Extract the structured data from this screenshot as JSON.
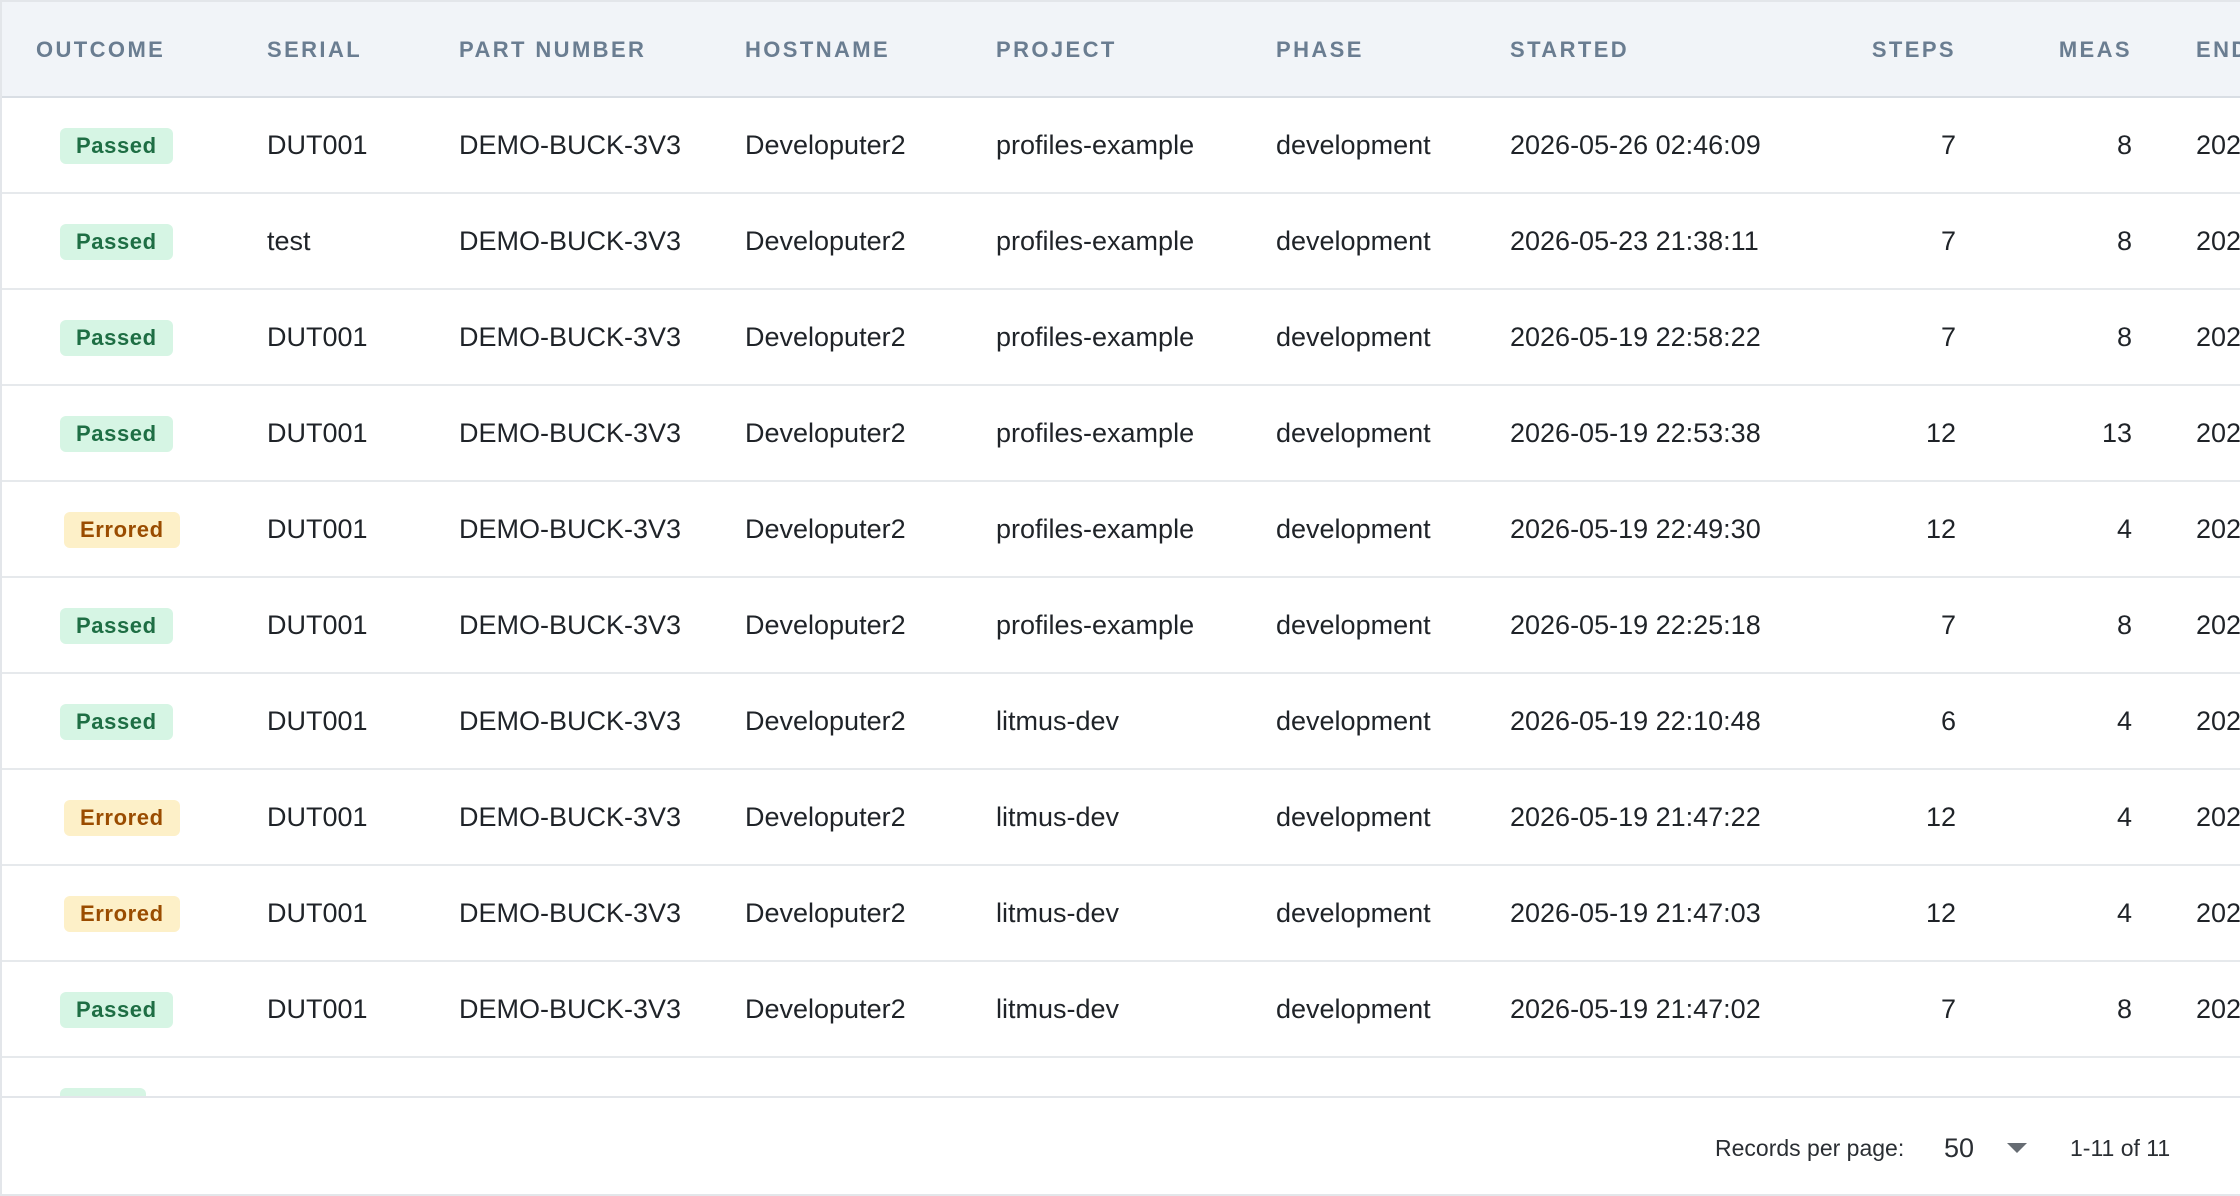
{
  "columns": {
    "outcome": "OUTCOME",
    "serial": "SERIAL",
    "part_number": "PART NUMBER",
    "hostname": "HOSTNAME",
    "project": "PROJECT",
    "phase": "PHASE",
    "started": "STARTED",
    "steps": "STEPS",
    "meas": "MEAS",
    "ended": "END"
  },
  "rows": [
    {
      "outcome": "Passed",
      "serial": "DUT001",
      "part_number": "DEMO-BUCK-3V3",
      "hostname": "Developuter2",
      "project": "profiles-example",
      "phase": "development",
      "started": "2026-05-26 02:46:09",
      "steps": "7",
      "meas": "8",
      "ended": "202"
    },
    {
      "outcome": "Passed",
      "serial": "test",
      "part_number": "DEMO-BUCK-3V3",
      "hostname": "Developuter2",
      "project": "profiles-example",
      "phase": "development",
      "started": "2026-05-23 21:38:11",
      "steps": "7",
      "meas": "8",
      "ended": "202"
    },
    {
      "outcome": "Passed",
      "serial": "DUT001",
      "part_number": "DEMO-BUCK-3V3",
      "hostname": "Developuter2",
      "project": "profiles-example",
      "phase": "development",
      "started": "2026-05-19 22:58:22",
      "steps": "7",
      "meas": "8",
      "ended": "202"
    },
    {
      "outcome": "Passed",
      "serial": "DUT001",
      "part_number": "DEMO-BUCK-3V3",
      "hostname": "Developuter2",
      "project": "profiles-example",
      "phase": "development",
      "started": "2026-05-19 22:53:38",
      "steps": "12",
      "meas": "13",
      "ended": "202"
    },
    {
      "outcome": "Errored",
      "serial": "DUT001",
      "part_number": "DEMO-BUCK-3V3",
      "hostname": "Developuter2",
      "project": "profiles-example",
      "phase": "development",
      "started": "2026-05-19 22:49:30",
      "steps": "12",
      "meas": "4",
      "ended": "202"
    },
    {
      "outcome": "Passed",
      "serial": "DUT001",
      "part_number": "DEMO-BUCK-3V3",
      "hostname": "Developuter2",
      "project": "profiles-example",
      "phase": "development",
      "started": "2026-05-19 22:25:18",
      "steps": "7",
      "meas": "8",
      "ended": "202"
    },
    {
      "outcome": "Passed",
      "serial": "DUT001",
      "part_number": "DEMO-BUCK-3V3",
      "hostname": "Developuter2",
      "project": "litmus-dev",
      "phase": "development",
      "started": "2026-05-19 22:10:48",
      "steps": "6",
      "meas": "4",
      "ended": "202"
    },
    {
      "outcome": "Errored",
      "serial": "DUT001",
      "part_number": "DEMO-BUCK-3V3",
      "hostname": "Developuter2",
      "project": "litmus-dev",
      "phase": "development",
      "started": "2026-05-19 21:47:22",
      "steps": "12",
      "meas": "4",
      "ended": "202"
    },
    {
      "outcome": "Errored",
      "serial": "DUT001",
      "part_number": "DEMO-BUCK-3V3",
      "hostname": "Developuter2",
      "project": "litmus-dev",
      "phase": "development",
      "started": "2026-05-19 21:47:03",
      "steps": "12",
      "meas": "4",
      "ended": "202"
    },
    {
      "outcome": "Passed",
      "serial": "DUT001",
      "part_number": "DEMO-BUCK-3V3",
      "hostname": "Developuter2",
      "project": "litmus-dev",
      "phase": "development",
      "started": "2026-05-19 21:47:02",
      "steps": "7",
      "meas": "8",
      "ended": "202"
    }
  ],
  "status_colors": {
    "passed_bg": "#d6f5e4",
    "passed_text": "#1e6e44",
    "errored_bg": "#fdf0c8",
    "errored_text": "#9a4c00"
  },
  "footer": {
    "records_per_page_label": "Records per page:",
    "records_per_page_value": "50",
    "range_label": "1-11 of 11"
  }
}
